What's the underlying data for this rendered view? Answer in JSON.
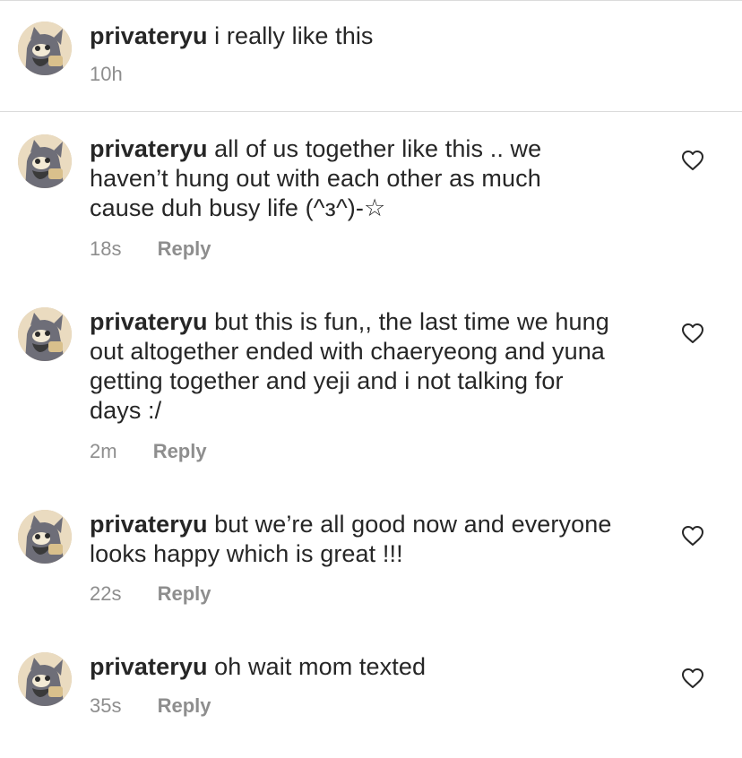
{
  "colors": {
    "text": "#262626",
    "meta": "#8e8e8e",
    "divider": "#dbdbdb",
    "heart_stroke": "#262626"
  },
  "caption": {
    "username": "privateryu",
    "text": "i really like this",
    "time": "10h"
  },
  "comments": [
    {
      "username": "privateryu",
      "text": "all of us together like this .. we haven’t hung out with each other as much cause duh busy life (^з^)-☆",
      "time": "18s",
      "reply_label": "Reply",
      "like_icon": "heart-outline-icon"
    },
    {
      "username": "privateryu",
      "text": "but this is fun,, the last time we hung out altogether ended with chaeryeong and yuna getting together and yeji and i not talking for days :/",
      "time": "2m",
      "reply_label": "Reply",
      "like_icon": "heart-outline-icon"
    },
    {
      "username": "privateryu",
      "text": "but we’re all good now and everyone looks happy which is great !!!",
      "time": "22s",
      "reply_label": "Reply",
      "like_icon": "heart-outline-icon"
    },
    {
      "username": "privateryu",
      "text": "oh wait mom texted",
      "time": "35s",
      "reply_label": "Reply",
      "like_icon": "heart-outline-icon"
    }
  ]
}
